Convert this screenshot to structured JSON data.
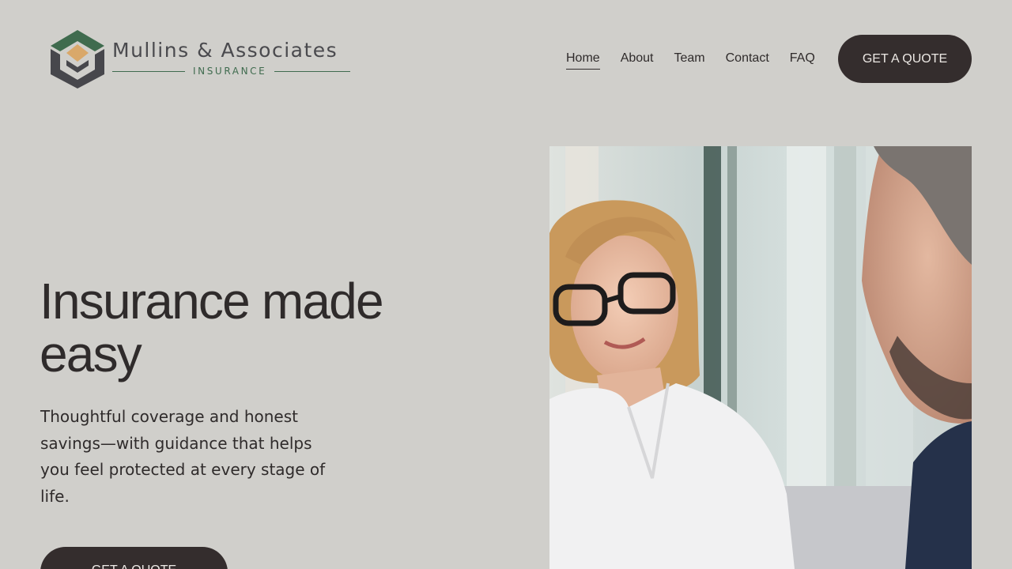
{
  "brand": {
    "name": "Mullins & Associates",
    "tagline": "INSURANCE",
    "colors": {
      "green": "#3f6b4e",
      "gold": "#d9a86a",
      "charcoal": "#47474c"
    }
  },
  "nav": {
    "items": [
      {
        "label": "Home",
        "active": true
      },
      {
        "label": "About",
        "active": false
      },
      {
        "label": "Team",
        "active": false
      },
      {
        "label": "Contact",
        "active": false
      },
      {
        "label": "FAQ",
        "active": false
      }
    ],
    "cta_label": "GET A QUOTE"
  },
  "hero": {
    "title": "Insurance made easy",
    "body": "Thoughtful coverage and honest savings—with guidance that helps you feel protected at every stage of life.",
    "cta_label": "GET A QUOTE"
  },
  "theme": {
    "background": "#d0cfcb",
    "text": "#2f2b2b",
    "button_bg": "#342d2d",
    "button_text": "#ece8e4"
  }
}
